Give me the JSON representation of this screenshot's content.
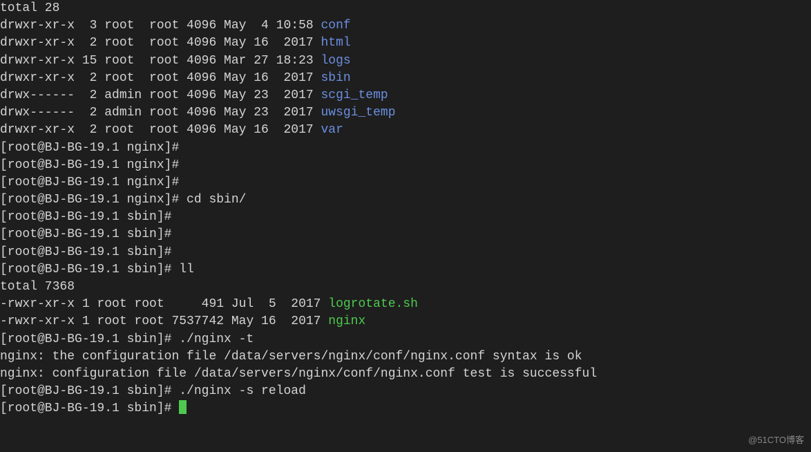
{
  "lines": [
    {
      "segments": [
        {
          "text": "total 28",
          "cls": "plain"
        }
      ]
    },
    {
      "segments": [
        {
          "text": "drwxr-xr-x  3 root  root 4096 May  4 10:58 ",
          "cls": "plain"
        },
        {
          "text": "conf",
          "cls": "dir-color"
        }
      ]
    },
    {
      "segments": [
        {
          "text": "drwxr-xr-x  2 root  root 4096 May 16  2017 ",
          "cls": "plain"
        },
        {
          "text": "html",
          "cls": "dir-color"
        }
      ]
    },
    {
      "segments": [
        {
          "text": "drwxr-xr-x 15 root  root 4096 Mar 27 18:23 ",
          "cls": "plain"
        },
        {
          "text": "logs",
          "cls": "dir-color"
        }
      ]
    },
    {
      "segments": [
        {
          "text": "drwxr-xr-x  2 root  root 4096 May 16  2017 ",
          "cls": "plain"
        },
        {
          "text": "sbin",
          "cls": "dir-color"
        }
      ]
    },
    {
      "segments": [
        {
          "text": "drwx------  2 admin root 4096 May 23  2017 ",
          "cls": "plain"
        },
        {
          "text": "scgi_temp",
          "cls": "dir-color"
        }
      ]
    },
    {
      "segments": [
        {
          "text": "drwx------  2 admin root 4096 May 23  2017 ",
          "cls": "plain"
        },
        {
          "text": "uwsgi_temp",
          "cls": "dir-color"
        }
      ]
    },
    {
      "segments": [
        {
          "text": "drwxr-xr-x  2 root  root 4096 May 16  2017 ",
          "cls": "plain"
        },
        {
          "text": "var",
          "cls": "dir-color"
        }
      ]
    },
    {
      "segments": [
        {
          "text": "[root@BJ-BG-19.1 nginx]# ",
          "cls": "plain"
        }
      ]
    },
    {
      "segments": [
        {
          "text": "[root@BJ-BG-19.1 nginx]# ",
          "cls": "plain"
        }
      ]
    },
    {
      "segments": [
        {
          "text": "[root@BJ-BG-19.1 nginx]# ",
          "cls": "plain"
        }
      ]
    },
    {
      "segments": [
        {
          "text": "[root@BJ-BG-19.1 nginx]# cd sbin/",
          "cls": "plain"
        }
      ]
    },
    {
      "segments": [
        {
          "text": "[root@BJ-BG-19.1 sbin]# ",
          "cls": "plain"
        }
      ]
    },
    {
      "segments": [
        {
          "text": "[root@BJ-BG-19.1 sbin]# ",
          "cls": "plain"
        }
      ]
    },
    {
      "segments": [
        {
          "text": "[root@BJ-BG-19.1 sbin]# ",
          "cls": "plain"
        }
      ]
    },
    {
      "segments": [
        {
          "text": "[root@BJ-BG-19.1 sbin]# ll",
          "cls": "plain"
        }
      ]
    },
    {
      "segments": [
        {
          "text": "total 7368",
          "cls": "plain"
        }
      ]
    },
    {
      "segments": [
        {
          "text": "-rwxr-xr-x 1 root root     491 Jul  5  2017 ",
          "cls": "plain"
        },
        {
          "text": "logrotate.sh",
          "cls": "exec-color"
        }
      ]
    },
    {
      "segments": [
        {
          "text": "-rwxr-xr-x 1 root root 7537742 May 16  2017 ",
          "cls": "plain"
        },
        {
          "text": "nginx",
          "cls": "exec-color"
        }
      ]
    },
    {
      "segments": [
        {
          "text": "[root@BJ-BG-19.1 sbin]# ./nginx -t",
          "cls": "plain"
        }
      ]
    },
    {
      "segments": [
        {
          "text": "nginx: the configuration file /data/servers/nginx/conf/nginx.conf syntax is ok",
          "cls": "plain"
        }
      ]
    },
    {
      "segments": [
        {
          "text": "nginx: configuration file /data/servers/nginx/conf/nginx.conf test is successful",
          "cls": "plain"
        }
      ]
    },
    {
      "segments": [
        {
          "text": "[root@BJ-BG-19.1 sbin]# ./nginx -s reload",
          "cls": "plain"
        }
      ]
    },
    {
      "segments": [
        {
          "text": "[root@BJ-BG-19.1 sbin]# ",
          "cls": "plain"
        }
      ],
      "cursor": true
    }
  ],
  "watermark": "@51CTO博客"
}
